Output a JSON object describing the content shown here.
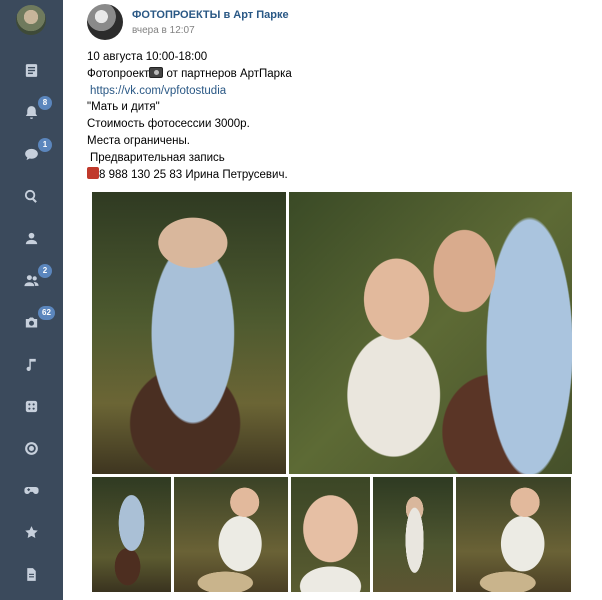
{
  "sidebar": {
    "items": [
      {
        "icon": "news-icon",
        "badge": ""
      },
      {
        "icon": "bell-icon",
        "badge": "8"
      },
      {
        "icon": "chat-icon",
        "badge": "1"
      },
      {
        "icon": "search-icon",
        "badge": ""
      },
      {
        "icon": "user-icon",
        "badge": ""
      },
      {
        "icon": "friends-icon",
        "badge": "2"
      },
      {
        "icon": "camera-icon",
        "badge": "62"
      },
      {
        "icon": "music-icon",
        "badge": ""
      },
      {
        "icon": "games-dice-icon",
        "badge": ""
      },
      {
        "icon": "target-icon",
        "badge": ""
      },
      {
        "icon": "gamepad-icon",
        "badge": ""
      },
      {
        "icon": "star-icon",
        "badge": ""
      },
      {
        "icon": "document-icon",
        "badge": ""
      }
    ]
  },
  "post": {
    "group_name": "ФОТОПРОЕКТЫ в Арт Парке",
    "time": "вчера в 12:07",
    "lines": {
      "date": "10 августа 10:00-18:00",
      "project_before": "Фотопроект",
      "project_after": " от партнеров АртПарка",
      "link": "https://vk.com/vpfotostudia",
      "title": "\"Мать и дитя\"",
      "price": "Стоимость фотосессии 3000р.",
      "limited": "Места ограничены.",
      "booking": "Предварительная запись",
      "phone": "8 988 130 25 83 Ирина Петрусевич."
    },
    "photo_count": 7
  },
  "colors": {
    "sidebar_bg": "#3b4a5c",
    "badge": "#5b86bd",
    "link": "#2a5885"
  }
}
